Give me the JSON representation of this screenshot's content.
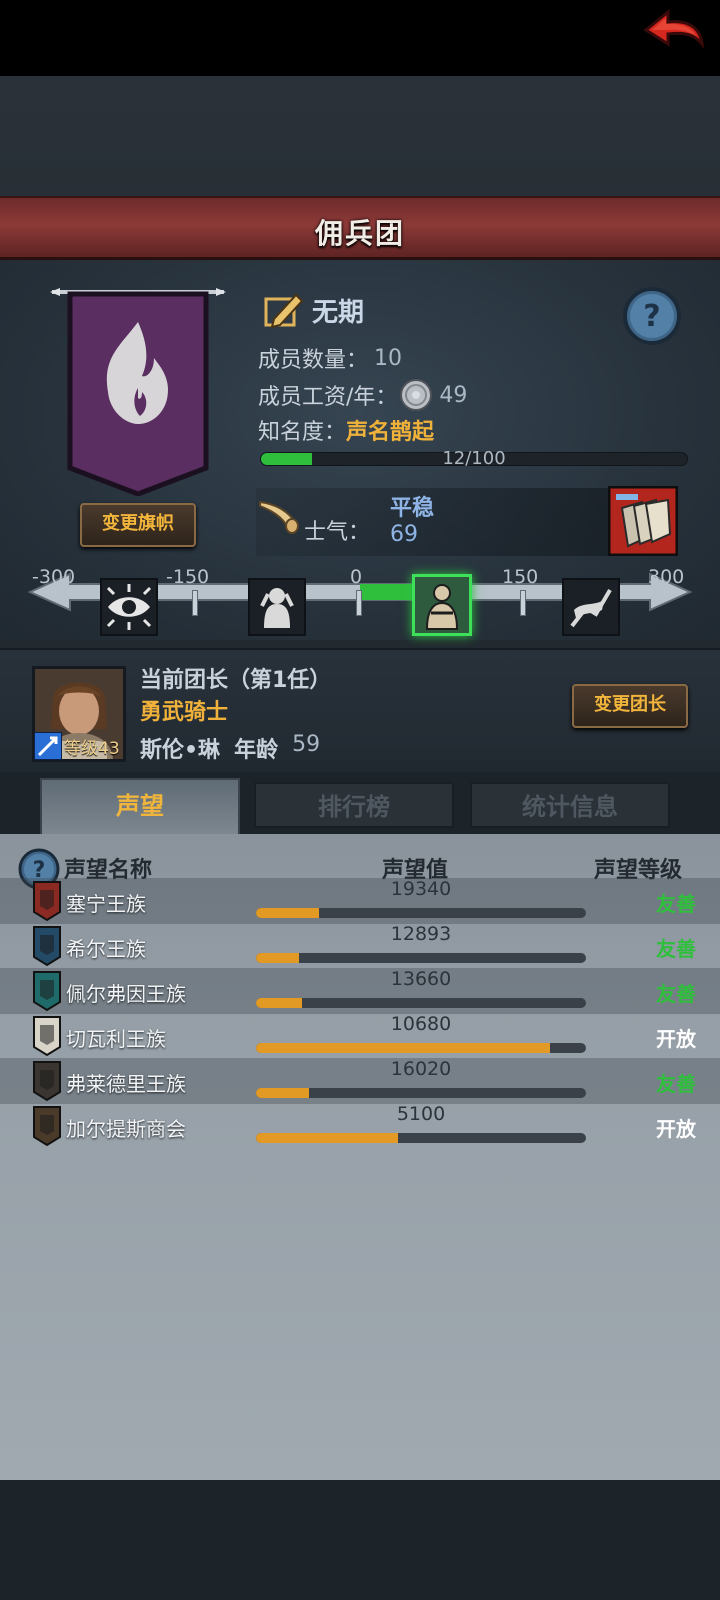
{
  "header": {
    "title": "佣兵团"
  },
  "company": {
    "name": "无期",
    "member_count_label": "成员数量：",
    "member_count": "10",
    "wage_label": "成员工资/年：",
    "wage": "49",
    "fame_label": "知名度：",
    "fame_state": "声名鹊起",
    "fame_progress_text": "12/100",
    "fame_progress_fraction": 0.12,
    "change_flag_label": "变更旗帜",
    "morale_label": "士气：",
    "morale_state": "平稳",
    "morale_value": "69"
  },
  "morale_scale": {
    "ticks": [
      "-300",
      "-150",
      "0",
      "150",
      "300"
    ],
    "icons": [
      "eye-icon",
      "despair-icon",
      "calm-figure-icon",
      "charge-icon"
    ],
    "active_index": 2
  },
  "leader": {
    "title": "当前团长（第1任）",
    "class": "勇武骑士",
    "name": "斯伦•琳",
    "age_label": "年龄",
    "age": "59",
    "level_label": "等级43",
    "change_leader_label": "变更团长"
  },
  "tabs": [
    {
      "label": "声望",
      "active": true
    },
    {
      "label": "排行榜",
      "active": false
    },
    {
      "label": "统计信息",
      "active": false
    }
  ],
  "reputation": {
    "col_name": "声望名称",
    "col_value": "声望值",
    "col_level": "声望等级",
    "rows": [
      {
        "name": "塞宁王族",
        "value": "19340",
        "level": "友善",
        "progress": 0.19,
        "crest_color": "#8b2a22"
      },
      {
        "name": "希尔王族",
        "value": "12893",
        "level": "友善",
        "progress": 0.13,
        "crest_color": "#234a66"
      },
      {
        "name": "佩尔弗因王族",
        "value": "13660",
        "level": "友善",
        "progress": 0.14,
        "crest_color": "#1f6b6a"
      },
      {
        "name": "切瓦利王族",
        "value": "10680",
        "level": "开放",
        "progress": 0.89,
        "crest_color": "#d9d4c8"
      },
      {
        "name": "弗莱德里王族",
        "value": "16020",
        "level": "友善",
        "progress": 0.16,
        "crest_color": "#3a3530"
      },
      {
        "name": "加尔提斯商会",
        "value": "5100",
        "level": "开放",
        "progress": 0.43,
        "crest_color": "#4a3a2a"
      }
    ]
  },
  "colors": {
    "friendly": "#2fbf3d",
    "open": "#ffffff",
    "accent_gold": "#f0b23a",
    "banner_purple": "#5a2e60"
  }
}
